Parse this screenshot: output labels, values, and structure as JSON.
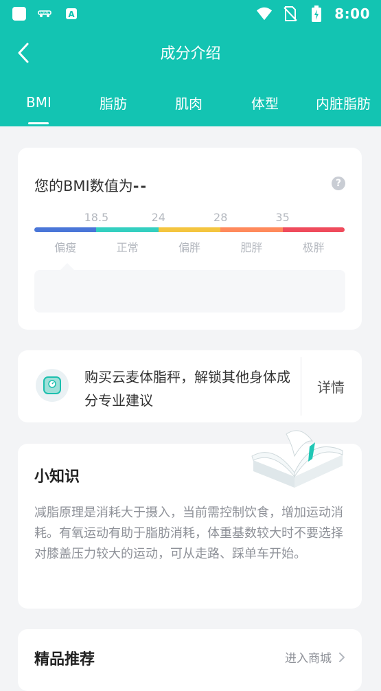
{
  "status": {
    "time": "8:00",
    "icons": [
      "square-icon",
      "carrier-icon",
      "font-icon",
      "wifi-icon",
      "no-sim-icon",
      "battery-charging-icon"
    ]
  },
  "header": {
    "title": "成分介绍",
    "back_icon": "chevron-left-icon"
  },
  "tabs": [
    {
      "label": "BMI",
      "active": true
    },
    {
      "label": "脂肪",
      "active": false
    },
    {
      "label": "肌肉",
      "active": false
    },
    {
      "label": "体型",
      "active": false
    },
    {
      "label": "内脏脂肪",
      "active": false
    }
  ],
  "bmi": {
    "title": "您的BMI数值为",
    "value": "--",
    "help_icon": "question-circle-icon",
    "thresholds": [
      "18.5",
      "24",
      "28",
      "35"
    ],
    "labels": [
      "偏瘦",
      "正常",
      "偏胖",
      "肥胖",
      "极胖"
    ],
    "colors": [
      "#4a76d8",
      "#34cfc0",
      "#f4c53f",
      "#ff8a5c",
      "#ef4b5c"
    ]
  },
  "promo": {
    "icon": "scale-icon",
    "text": "购买云麦体脂秤，解锁其他身体成分专业建议",
    "detail_label": "详情"
  },
  "tip": {
    "title": "小知识",
    "illustration": "open-book-icon",
    "body": "减脂原理是消耗大于摄入，当前需控制饮食，增加运动消耗。有氧运动有助于脂肪消耗，体重基数较大时不要选择对膝盖压力较大的运动，可从走路、踩单车开始。"
  },
  "recommend": {
    "title": "精品推荐",
    "link_label": "进入商城",
    "link_icon": "chevron-right-icon"
  }
}
